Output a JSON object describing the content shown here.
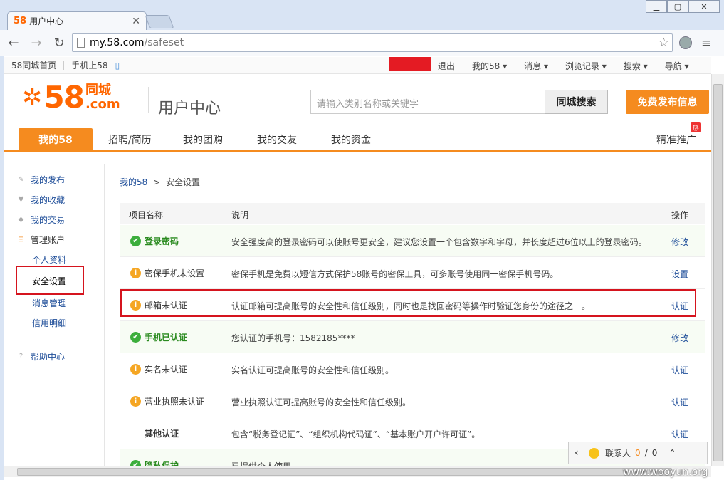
{
  "browser": {
    "tab_logo": "58",
    "tab_title": "用户中心",
    "url_host": "my.58.com",
    "url_path": "/safeset"
  },
  "topbar": {
    "home": "58同城首页",
    "mobile": "手机上58",
    "logout": "退出",
    "my58": "我的58 ▾",
    "messages": "消息 ▾",
    "history": "浏览记录 ▾",
    "search": "搜索 ▾",
    "guide": "导航 ▾"
  },
  "header": {
    "logo_number": "58",
    "logo_cn": "同城",
    "logo_com": ".com",
    "title": "用户中心",
    "search_placeholder": "请输入类别名称或关键字",
    "search_button": "同城搜索",
    "post_button": "免费发布信息"
  },
  "nav": {
    "items": [
      "我的58",
      "招聘/简历",
      "我的团购",
      "我的交友",
      "我的资金"
    ],
    "right": "精准推广",
    "hot_badge": "热"
  },
  "sidebar": {
    "items": [
      "我的发布",
      "我的收藏",
      "我的交易",
      "管理账户",
      "个人资料",
      "安全设置",
      "消息管理",
      "信用明细",
      "帮助中心"
    ]
  },
  "breadcrumb": {
    "root": "我的58",
    "sep": ">",
    "current": "安全设置"
  },
  "table": {
    "headers": [
      "项目名称",
      "说明",
      "操作"
    ],
    "rows": [
      {
        "name": "登录密码",
        "status": "ok",
        "desc": "安全强度高的登录密码可以使账号更安全，建议您设置一个包含数字和字母，并长度超过6位以上的登录密码。",
        "action": "修改"
      },
      {
        "name": "密保手机未设置",
        "status": "warn",
        "desc": "密保手机是免费以短信方式保护58账号的密保工具，可多账号使用同一密保手机号码。",
        "action": "设置"
      },
      {
        "name": "邮箱未认证",
        "status": "warn",
        "desc": "认证邮箱可提高账号的安全性和信任级别，同时也是找回密码等操作时验证您身份的途径之一。",
        "action": "认证"
      },
      {
        "name": "手机已认证",
        "status": "ok",
        "desc": "您认证的手机号：1582185****",
        "action": "修改"
      },
      {
        "name": "实名未认证",
        "status": "warn",
        "desc": "实名认证可提高账号的安全性和信任级别。",
        "action": "认证"
      },
      {
        "name": "营业执照未认证",
        "status": "warn",
        "desc": "营业执照认证可提高账号的安全性和信任级别。",
        "action": "认证"
      },
      {
        "name": "其他认证",
        "status": "none",
        "desc": "包含“税务登记证”、“组织机构代码证”、“基本账户开户许可证”。",
        "action": "认证"
      },
      {
        "name": "隐私保护",
        "status": "ok",
        "desc": "已提供个人使用",
        "action": ""
      }
    ]
  },
  "contact": {
    "label": "联系人",
    "count_a": "0",
    "slash": "/",
    "count_b": "0"
  },
  "watermark": "www.wooyun.org"
}
